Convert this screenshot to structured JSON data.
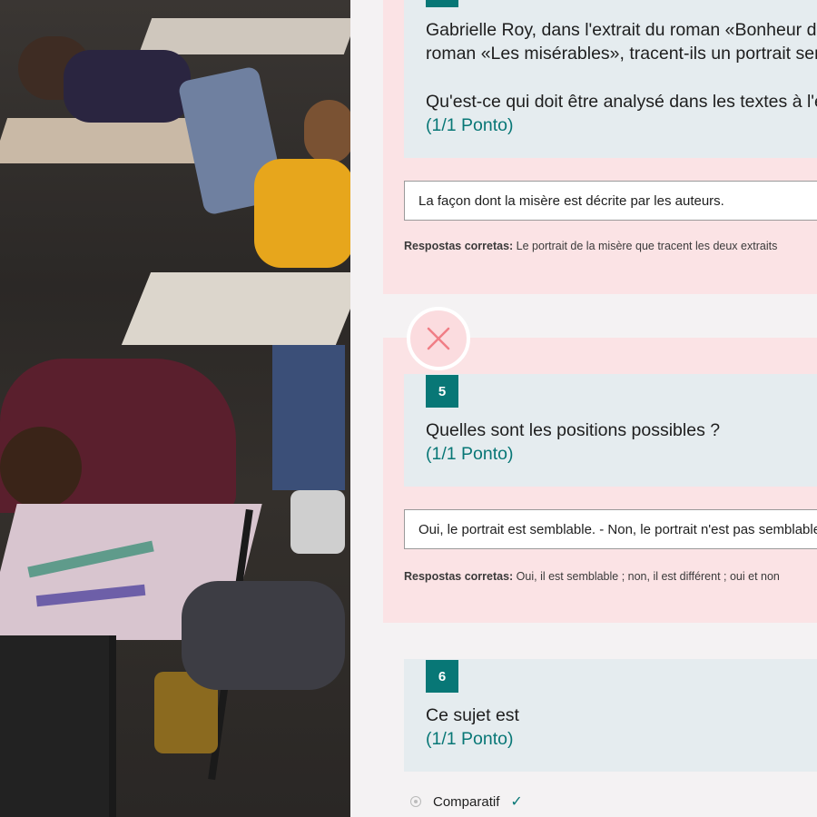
{
  "photo": {
    "name": "students-exam-photo"
  },
  "questions": [
    {
      "id": "q4",
      "status": "wrong",
      "text_line1": "Gabrielle Roy, dans l'extrait du roman «Bonheur d'occasion»,",
      "text_line2": "roman «Les misérables», tracent-ils un portrait semblable ?",
      "prompt": "Qu'est-ce qui doit être analysé dans les textes à l'étude ?",
      "points": "(1/1 Ponto)",
      "answer": "La façon dont la misère est décrite par les auteurs.",
      "correct_label": "Respostas corretas:",
      "correct_text": " Le portrait de la misère que tracent les deux extraits"
    },
    {
      "id": "q5",
      "number": "5",
      "status": "wrong",
      "text": "Quelles sont les positions possibles ?",
      "points": "(1/1 Ponto)",
      "answer": "Oui, le portrait est semblable. - Non, le portrait n'est pas semblable.",
      "correct_label": "Respostas corretas:",
      "correct_text": " Oui, il est semblable ; non, il est différent ; oui et non"
    },
    {
      "id": "q6",
      "number": "6",
      "text": "Ce sujet est",
      "points": "(1/1 Ponto)",
      "option": "Comparatif"
    }
  ],
  "colors": {
    "accent": "#087776",
    "wrong_bg": "#fbe3e5",
    "question_bg": "#e5ecef",
    "wrong_icon": "#f07e86"
  },
  "icons": {
    "wrong": "close-icon",
    "correct": "checkmark-icon"
  }
}
